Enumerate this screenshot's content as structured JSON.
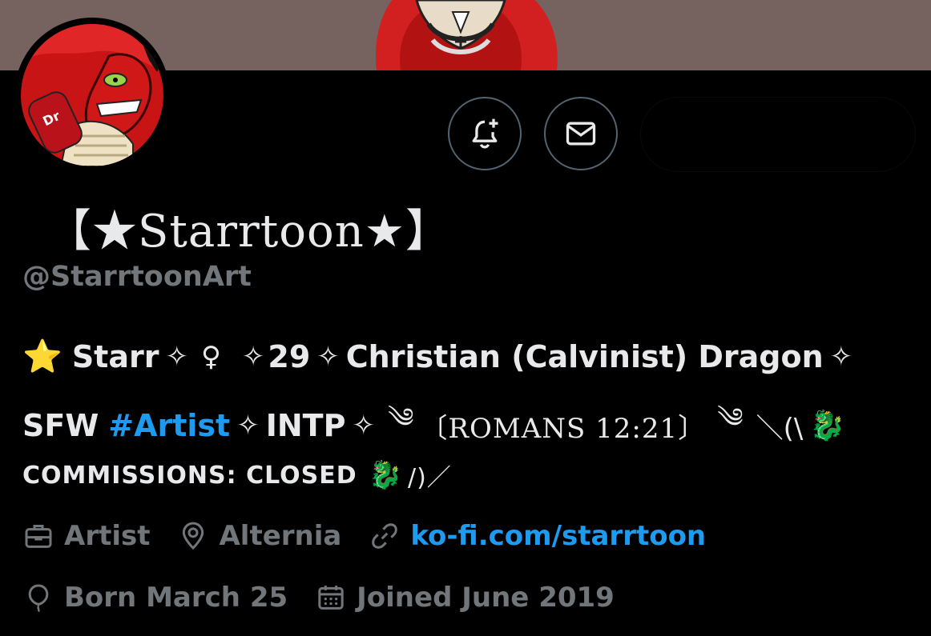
{
  "profile": {
    "display_name": "【★Starrtoon★】",
    "handle": "@StarrtoonArt"
  },
  "bio": {
    "star_emoji": "⭐",
    "name": "Starr",
    "sparkle": "✧",
    "female_symbol": "♀",
    "age": "29",
    "description": "Christian (Calvinist) Dragon",
    "sfw": "SFW",
    "hashtag": "#Artist",
    "mbti": "INTP",
    "wind_left": "༄",
    "verse": "〔ROMANS 12:21〕",
    "wind_right": "༄",
    "slashes_right": "＼(\\",
    "dragon_emoji": "🐉",
    "commissions": "COMMISSIONS: CLOSED",
    "slashes_left": "/)／"
  },
  "meta": {
    "profession": "Artist",
    "location": "Alternia",
    "website": "ko-fi.com/starrtoon",
    "birthday": "Born March 25",
    "joined": "Joined June 2019"
  },
  "icons": {
    "notify": "bell-plus-icon",
    "message": "envelope-icon",
    "profession": "briefcase-icon",
    "location": "map-pin-icon",
    "website": "link-icon",
    "birthday": "balloon-icon",
    "joined": "calendar-icon"
  },
  "colors": {
    "background": "#000000",
    "banner": "#76625f",
    "text_primary": "#e7e9ea",
    "text_secondary": "#71767b",
    "accent": "#1d9bf0",
    "border": "#536471"
  }
}
